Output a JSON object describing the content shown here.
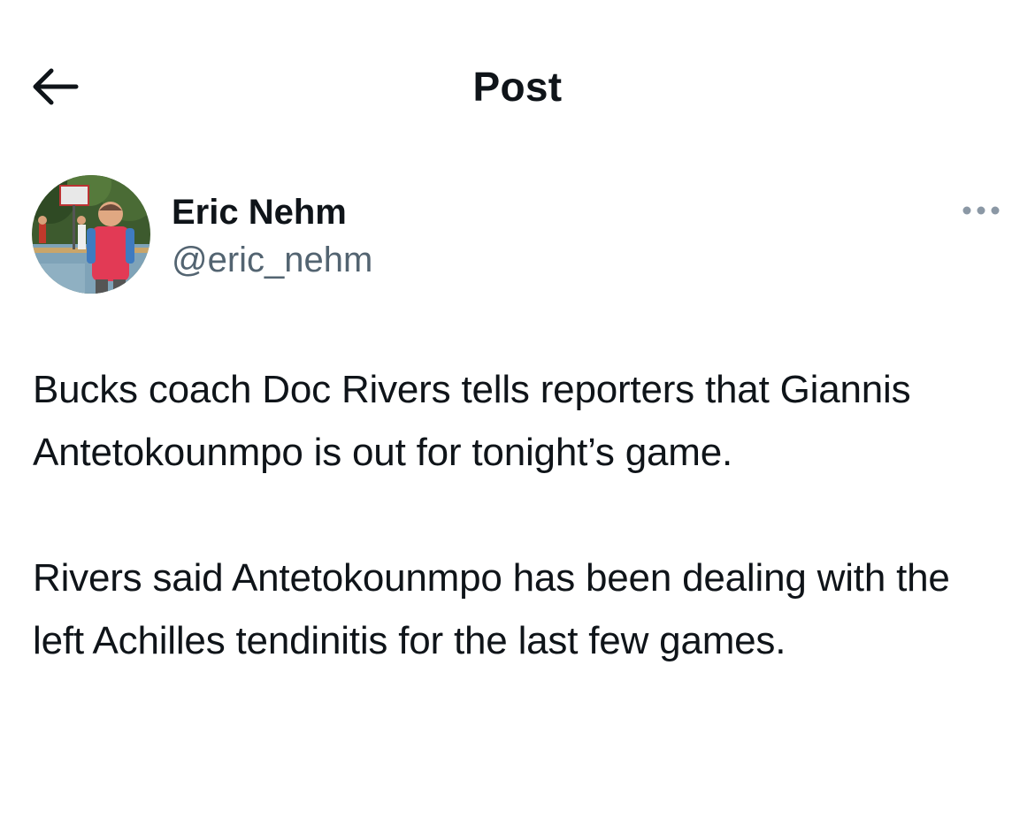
{
  "header": {
    "back_icon": "arrow-left-icon",
    "title": "Post"
  },
  "author": {
    "avatar_icon": "profile-photo",
    "name": "Eric Nehm",
    "handle": "@eric_nehm",
    "more_icon": "ellipsis-icon"
  },
  "post": {
    "paragraphs": [
      "Bucks coach Doc Rivers tells reporters that Giannis Antetokounmpo is out for tonight’s game.",
      "Rivers said Antetokounmpo has been dealing with the left Achilles tendinitis for the last few games."
    ]
  },
  "colors": {
    "text": "#0f1419",
    "secondary_text": "#536471",
    "more_dots": "#8b98a5",
    "background": "#ffffff"
  }
}
